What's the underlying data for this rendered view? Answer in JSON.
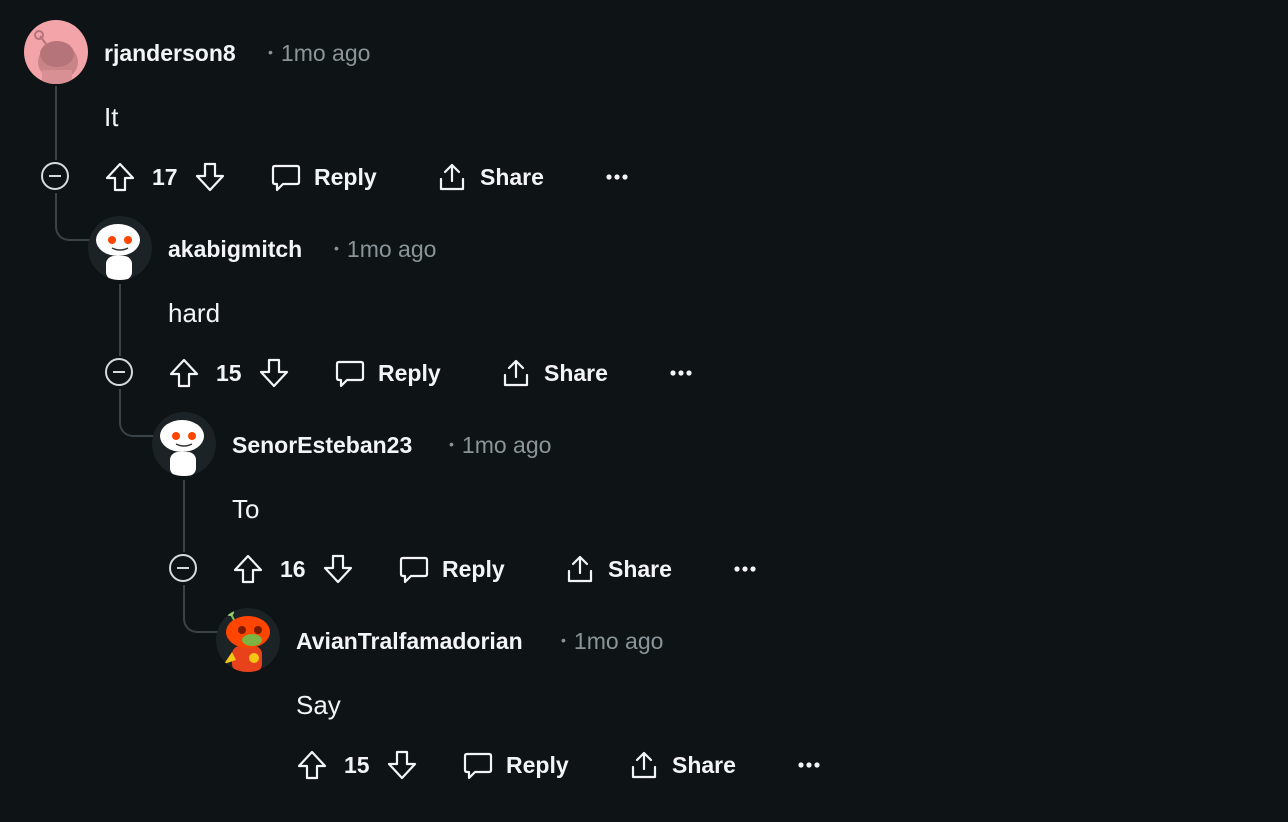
{
  "comments": [
    {
      "username": "rjanderson8",
      "time": "1mo ago",
      "text": "It",
      "votes": "17",
      "avatar": "pink-snoo-avatar"
    },
    {
      "username": "akabigmitch",
      "time": "1mo ago",
      "text": "hard",
      "votes": "15",
      "avatar": "white-snoo-avatar"
    },
    {
      "username": "SenorEsteban23",
      "time": "1mo ago",
      "text": "To",
      "votes": "16",
      "avatar": "white-snoo-avatar"
    },
    {
      "username": "AvianTralfamadorian",
      "time": "1mo ago",
      "text": "Say",
      "votes": "15",
      "avatar": "orange-snoo-avatar"
    }
  ],
  "labels": {
    "reply": "Reply",
    "share": "Share",
    "separator": "•"
  },
  "colors": {
    "background": "#0e1416",
    "text": "#f2f4f5",
    "muted": "#8a9599",
    "thread_line": "#3a4347"
  }
}
